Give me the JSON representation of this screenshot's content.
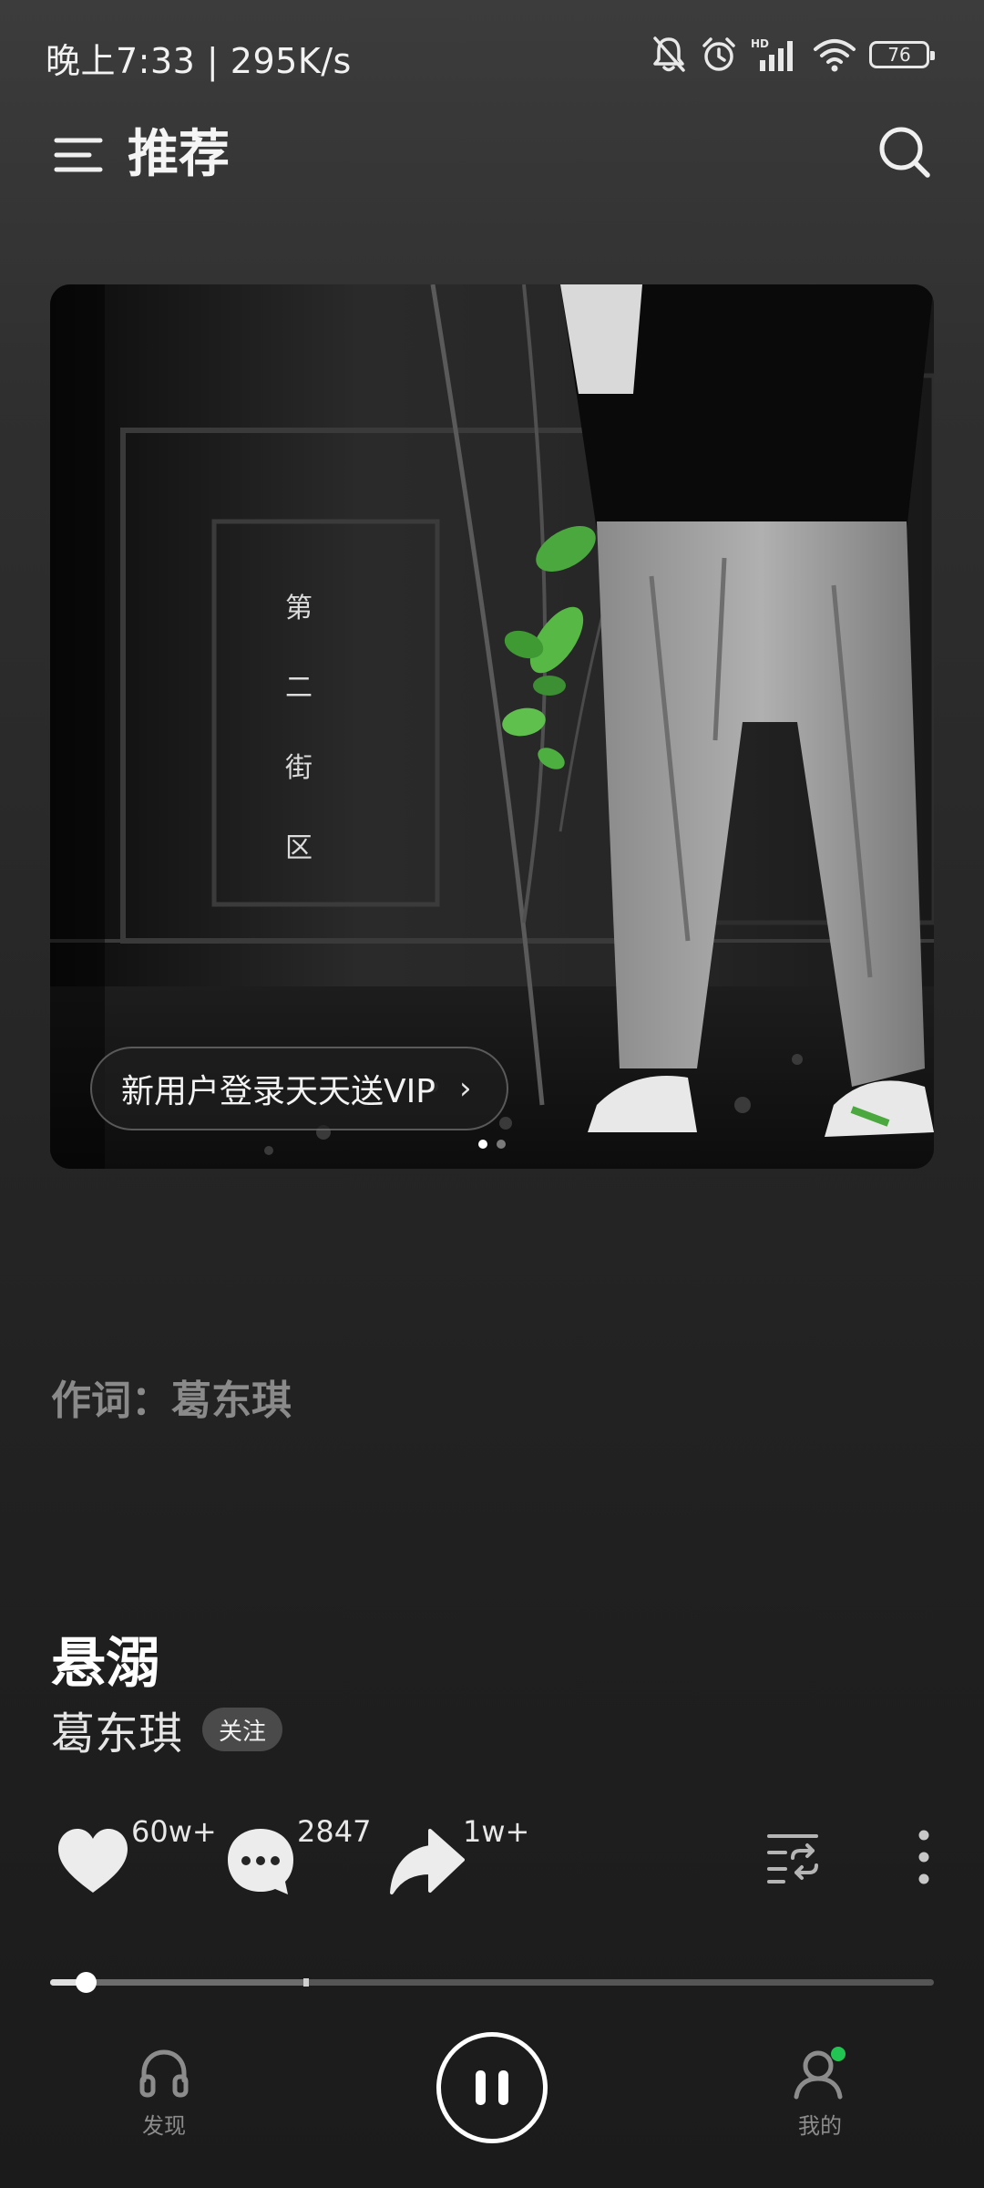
{
  "status_bar": {
    "time": "晚上7:33 | 295K/s",
    "battery": "76",
    "icons": [
      "mute-bell-icon",
      "alarm-icon",
      "hd-signal-icon",
      "wifi-icon",
      "battery-icon"
    ]
  },
  "header": {
    "title": "推荐",
    "menu_icon": "menu-icon",
    "search_icon": "search-icon"
  },
  "banner": {
    "vip_label": "新用户登录天天送VIP",
    "vip_chevron": "›",
    "album_text": "第 二 街 区",
    "dots": 2,
    "active_dot": 0
  },
  "lyrics": {
    "current": "作词：葛东琪"
  },
  "song": {
    "title": "悬溺",
    "artist": "葛东琪",
    "follow_label": "关注"
  },
  "actions": {
    "like_count": "60w+",
    "comment_count": "2847",
    "share_count": "1w+"
  },
  "progress": {
    "played_fraction": 0.04,
    "buffered_fraction": 0.29
  },
  "bottom_nav": {
    "discover_label": "发现",
    "mine_label": "我的",
    "notification_dot_color": "#23c552"
  }
}
